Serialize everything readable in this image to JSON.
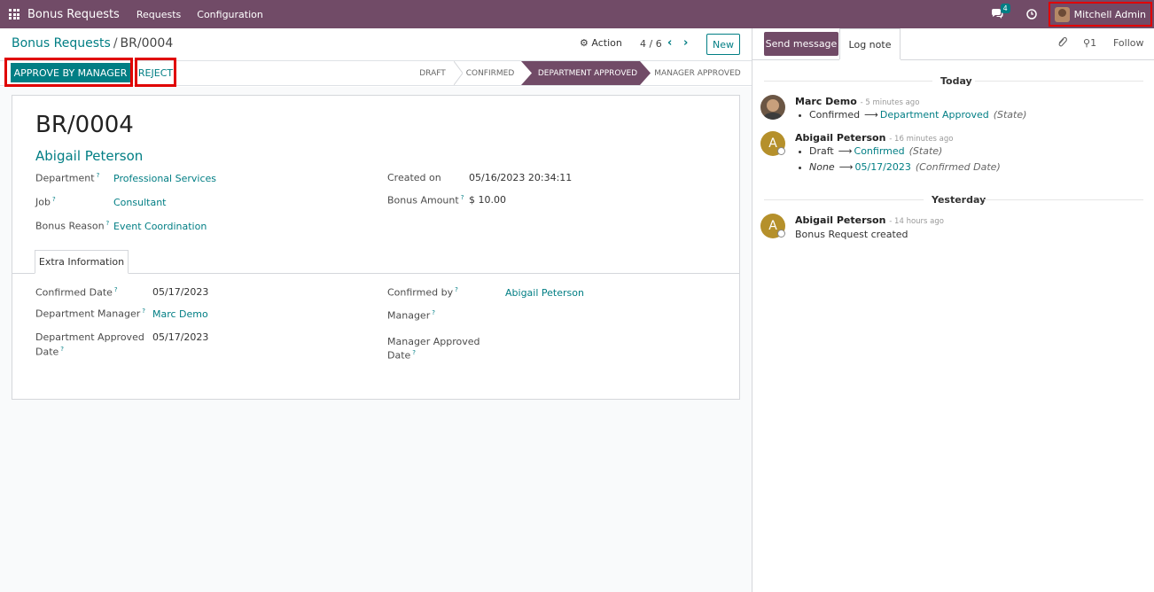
{
  "navbar": {
    "app_title": "Bonus Requests",
    "menus": [
      "Requests",
      "Configuration"
    ],
    "messages_badge": "4",
    "user_name": "Mitchell Admin",
    "icons": [
      "apps-grid-icon",
      "chat-icon",
      "clock-icon"
    ]
  },
  "breadcrumb": {
    "parent": "Bonus Requests",
    "separator": "/",
    "current": "BR/0004"
  },
  "control": {
    "action_label": "Action",
    "pager": "4 / 6",
    "new_label": "New"
  },
  "buttons": {
    "approve": "APPROVE BY MANAGER",
    "reject": "REJECT"
  },
  "statusbar": {
    "stages": [
      "DRAFT",
      "CONFIRMED",
      "DEPARTMENT APPROVED",
      "MANAGER APPROVED"
    ],
    "active": "DEPARTMENT APPROVED"
  },
  "record": {
    "name": "BR/0004",
    "employee": "Abigail Peterson",
    "fields_left": [
      {
        "label": "Department",
        "value": "Professional Services"
      },
      {
        "label": "Job",
        "value": "Consultant"
      },
      {
        "label": "Bonus Reason",
        "value": "Event Coordination"
      }
    ],
    "fields_right": [
      {
        "label": "Created on",
        "value": "05/16/2023 20:34:11"
      },
      {
        "label": "Bonus Amount",
        "value": "$ 10.00"
      }
    ],
    "help_mark": "?"
  },
  "tab": {
    "label": "Extra Information",
    "fields_left": [
      {
        "label": "Confirmed Date",
        "value": "05/17/2023"
      },
      {
        "label": "Department Manager",
        "value": "Marc Demo"
      },
      {
        "label_line1": "Department Approved",
        "label_line2": "Date",
        "value": "05/17/2023"
      }
    ],
    "fields_right": [
      {
        "label": "Confirmed by",
        "value": "Abigail Peterson"
      },
      {
        "label": "Manager",
        "value": ""
      },
      {
        "label_line1": "Manager Approved",
        "label_line2": "Date",
        "value": ""
      }
    ]
  },
  "chatter": {
    "send_message": "Send message",
    "log_note": "Log note",
    "followers_count": "1",
    "follow": "Follow",
    "day_today": "Today",
    "day_yesterday": "Yesterday",
    "messages": [
      {
        "author": "Marc Demo",
        "time": "- 5 minutes ago",
        "changes": [
          {
            "old": "Confirmed",
            "new": "Department Approved",
            "field": "(State)"
          }
        ]
      },
      {
        "author": "Abigail Peterson",
        "initial": "A",
        "time": "- 16 minutes ago",
        "changes": [
          {
            "old": "Draft",
            "new": "Confirmed",
            "field": "(State)"
          },
          {
            "old": "None",
            "new": "05/17/2023",
            "field": "(Confirmed Date)"
          }
        ]
      },
      {
        "author": "Abigail Peterson",
        "initial": "A",
        "time": "- 14 hours ago",
        "body": "Bonus Request created"
      }
    ]
  },
  "colors": {
    "brand": "#714b67",
    "accent": "#017e84",
    "highlight_box": "#e00000"
  }
}
